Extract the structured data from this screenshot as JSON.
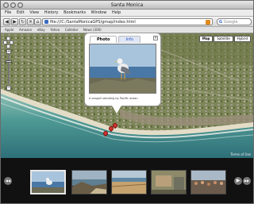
{
  "window": {
    "title": "Santa Monica"
  },
  "menu": [
    "File",
    "Edit",
    "View",
    "History",
    "Bookmarks",
    "Window",
    "Help"
  ],
  "toolbar": {
    "back": "◀",
    "forward": "▶",
    "reload": "↻",
    "stop": "✕",
    "home": "⌂",
    "url": "file:///C:/SantaMonicaGPS/gmap/index.html",
    "search_engine": "G",
    "search_placeholder": "Google"
  },
  "bookmarks": [
    "Apple",
    "Amazon",
    "eBay",
    "Yahoo",
    "Calledar",
    "News (300)"
  ],
  "map": {
    "types": [
      "Map",
      "Satellite",
      "Hybrid"
    ],
    "active_type": "Satellite",
    "copyright": "Terms of Use"
  },
  "infowindow": {
    "tabs": [
      "Photo",
      "Info"
    ],
    "active_tab": "Photo",
    "caption": "A seagull standing by Pacific ocean"
  },
  "filmstrip": {
    "prev": "◀◀",
    "next": "▶▶",
    "selected_index": 0,
    "thumbnails": [
      "seagull",
      "rocks-and-beach",
      "beach-sand",
      "sign",
      "crowd"
    ]
  },
  "colors": {
    "accent": "#3b6cc4",
    "marker": "#d4322e"
  }
}
